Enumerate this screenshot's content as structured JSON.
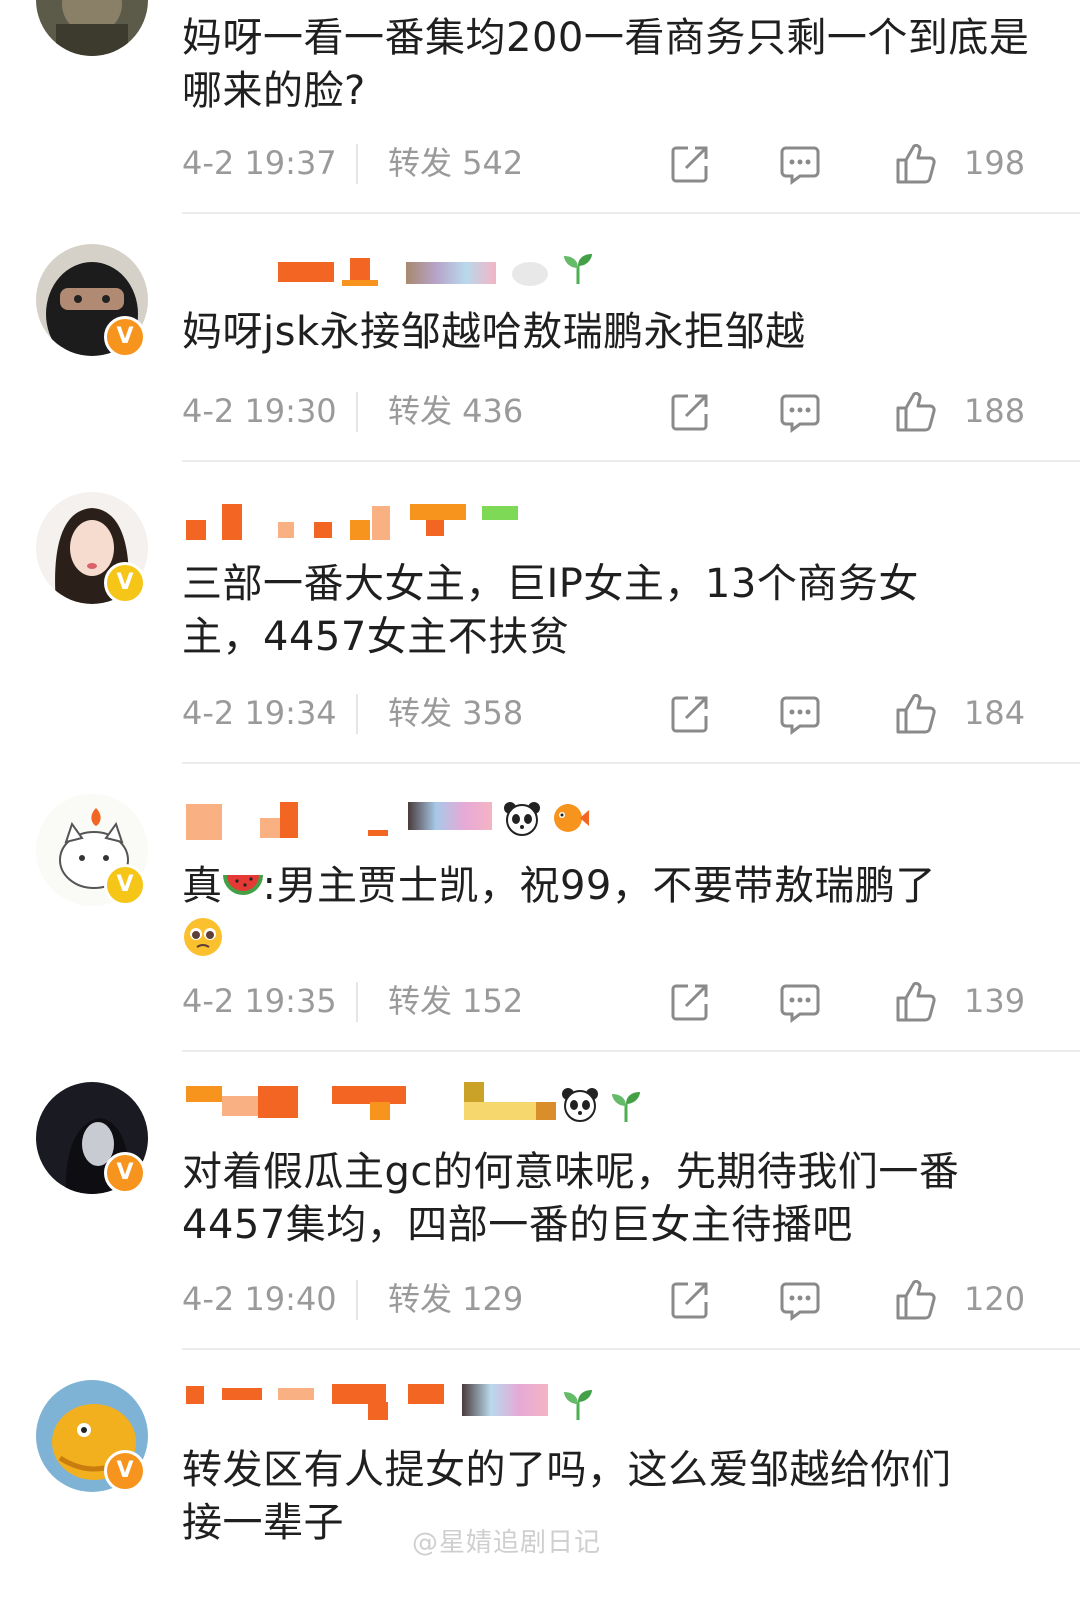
{
  "posts": [
    {
      "content": "妈呀一看一番集均200一看商务只剩一个到底是哪来的脸?",
      "time": "4-2 19:37",
      "repost": "转发 542",
      "likes": "198",
      "verified": false,
      "avatar_icon": "avatar-photo-icon"
    },
    {
      "content": "妈呀jsk永接邹越哈敖瑞鹏永拒邹越",
      "time": "4-2 19:30",
      "repost": "转发 436",
      "likes": "188",
      "verified": true,
      "badge_color": "#f7941d"
    },
    {
      "content_line1": "三部一番大女主，巨IP女主，13个商务女",
      "content_line2": "主，4457女主不扶贫",
      "time": "4-2 19:34",
      "repost": "转发 358",
      "likes": "184",
      "verified": true,
      "badge_color": "#f5c518"
    },
    {
      "content_prefix": "真",
      "content_suffix": ":男主贾士凯，祝99，不要带敖瑞鹏了",
      "emoji_watermelon": "watermelon-emoji-icon",
      "emoji_pleading": "pleading-emoji-icon",
      "time": "4-2 19:35",
      "repost": "转发 152",
      "likes": "139",
      "verified": true,
      "badge_color": "#f5c518"
    },
    {
      "content_line1": "对着假瓜主gc的何意味呢，先期待我们一番",
      "content_line2": "4457集均，四部一番的巨女主待播吧",
      "time": "4-2 19:40",
      "repost": "转发 129",
      "likes": "120",
      "verified": true,
      "badge_color": "#f7941d"
    },
    {
      "content_line1": "转发区有人提女的了吗，这么爱邹越给你们",
      "content_line2": "接一辈子",
      "verified": true,
      "badge_color": "#f7941d"
    }
  ],
  "icons": {
    "share": "share-icon",
    "comment": "comment-icon",
    "like": "thumbs-up-icon",
    "verified": "verified-v-icon"
  },
  "verified_letter": "V",
  "watermark": "@星婧追剧日记"
}
